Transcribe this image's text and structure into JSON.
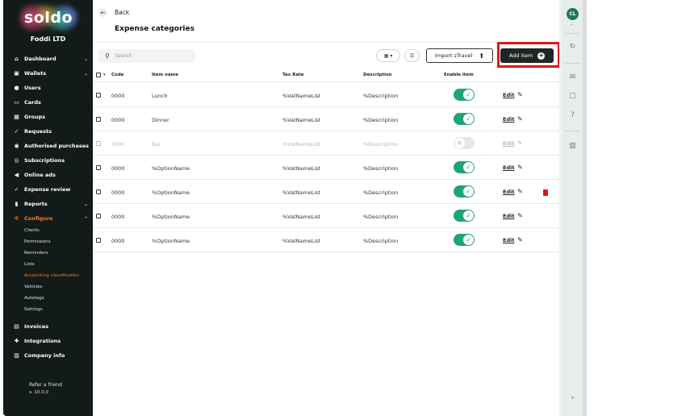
{
  "brand": {
    "logo_text": "soldo",
    "company": "Foddi LTD"
  },
  "nav": [
    {
      "label": "Dashboard",
      "icon": "home-icon",
      "glyph": "⌂",
      "has_chevron": true,
      "chevron": "⌄"
    },
    {
      "label": "Wallets",
      "icon": "wallet-icon",
      "glyph": "▣",
      "has_chevron": true,
      "chevron": "⌄"
    },
    {
      "label": "Users",
      "icon": "user-icon",
      "glyph": "●"
    },
    {
      "label": "Cards",
      "icon": "card-icon",
      "glyph": "▭"
    },
    {
      "label": "Groups",
      "icon": "groups-icon",
      "glyph": "▦"
    },
    {
      "label": "Requests",
      "icon": "requests-icon",
      "glyph": "✓"
    },
    {
      "label": "Authorised purchases",
      "icon": "authorised-icon",
      "glyph": "◉"
    },
    {
      "label": "Subscriptions",
      "icon": "subscriptions-icon",
      "glyph": "◎"
    },
    {
      "label": "Online ads",
      "icon": "megaphone-icon",
      "glyph": "◀"
    },
    {
      "label": "Expense review",
      "icon": "check-icon",
      "glyph": "✓"
    },
    {
      "label": "Reports",
      "icon": "chart-icon",
      "glyph": "▮",
      "has_chevron": true,
      "chevron": "⌄"
    },
    {
      "label": "Configure",
      "icon": "gear-icon",
      "glyph": "✲",
      "has_chevron": true,
      "chevron": "⌃",
      "active": true
    }
  ],
  "configure_sub": [
    {
      "label": "Clients"
    },
    {
      "label": "Permissions"
    },
    {
      "label": "Reminders"
    },
    {
      "label": "Lists"
    },
    {
      "label": "Accounting classification",
      "active": true
    },
    {
      "label": "Vehicles"
    },
    {
      "label": "Autotags"
    },
    {
      "label": "Settings"
    }
  ],
  "nav_bottom": [
    {
      "label": "Invoices",
      "icon": "invoice-icon",
      "glyph": "▤"
    },
    {
      "label": "Integrations",
      "icon": "puzzle-icon",
      "glyph": "✚"
    },
    {
      "label": "Company info",
      "icon": "building-icon",
      "glyph": "▥"
    }
  ],
  "footer": {
    "refer": "Refer a friend",
    "version": "v. 10.0.0"
  },
  "header": {
    "back_label": "Back",
    "back_glyph": "←",
    "title": "Expense categories"
  },
  "toolbar": {
    "search_placeholder": "Search",
    "search_glyph": "⚲",
    "grid_view_glyph": "▦ ▾",
    "list_view_glyph": "☰",
    "import_label": "Import zTravel",
    "import_glyph": "⬆",
    "add_label": "Add item",
    "add_glyph": "+"
  },
  "table": {
    "header_sort_glyph": "▾",
    "columns": [
      "Code",
      "Item name",
      "Tax Rate",
      "Description",
      "Enable item"
    ],
    "edit_label": "Edit",
    "edit_glyph": "✎",
    "toggle_on_glyph": "✓",
    "toggle_off_glyph": "✕",
    "rows": [
      {
        "code": "0000",
        "name": "Lunch",
        "tax": "%VatNameList",
        "desc": "%Description",
        "enabled": true
      },
      {
        "code": "0000",
        "name": "Dinner",
        "tax": "%VatNameList",
        "desc": "%Description",
        "enabled": true
      },
      {
        "code": "0000",
        "name": "Bar",
        "tax": "%VatNameList",
        "desc": "%Description",
        "enabled": false
      },
      {
        "code": "0000",
        "name": "%OptionName",
        "tax": "%VatNameList",
        "desc": "%Description",
        "enabled": true
      },
      {
        "code": "0000",
        "name": "%OptionName",
        "tax": "%VatNameList",
        "desc": "%Description",
        "enabled": true,
        "delete": true
      },
      {
        "code": "0000",
        "name": "%OptionName",
        "tax": "%VatNameList",
        "desc": "%Description",
        "enabled": true
      },
      {
        "code": "0000",
        "name": "%OptionName",
        "tax": "%VatNameList",
        "desc": "%Description",
        "enabled": true
      }
    ]
  },
  "rightbar": {
    "avatar": "CL",
    "avatar_chevron": "⌄",
    "icons": [
      {
        "name": "refresh-icon",
        "glyph": "↻"
      },
      {
        "name": "mail-icon",
        "glyph": "✉"
      },
      {
        "name": "chat-icon",
        "glyph": "▢"
      },
      {
        "name": "help-icon",
        "glyph": "?"
      },
      {
        "name": "bank-icon",
        "glyph": "▥"
      }
    ],
    "collapse_glyph": "›"
  },
  "colors": {
    "accent": "#f07e2a",
    "toggle_on": "#1da57a",
    "highlight": "#e0141e",
    "sidebar_bg": "#121a1a"
  }
}
